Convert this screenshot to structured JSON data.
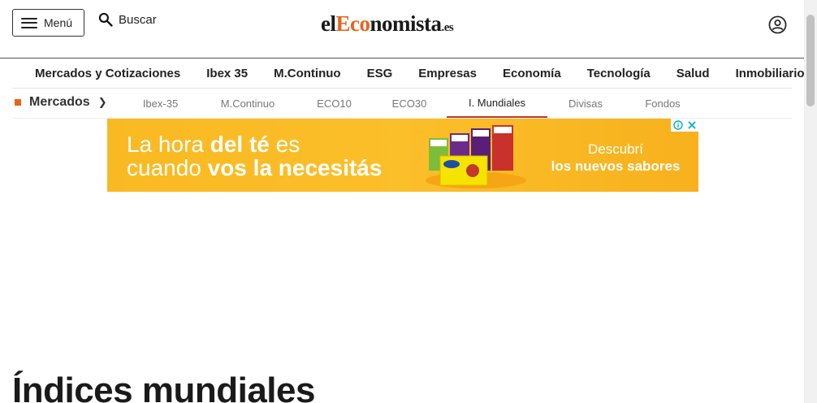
{
  "header": {
    "menu_label": "Menú",
    "search_label": "Buscar",
    "logo": {
      "part1": "el",
      "part2": "Eco",
      "part3": "nomista",
      "tld": ".es"
    }
  },
  "main_nav": [
    "Mercados y Cotizaciones",
    "Ibex 35",
    "M.Continuo",
    "ESG",
    "Empresas",
    "Economía",
    "Tecnología",
    "Salud",
    "Inmobiliario"
  ],
  "sub_nav": {
    "section_label": "Mercados",
    "tabs": [
      {
        "label": "Ibex-35",
        "active": false
      },
      {
        "label": "M.Continuo",
        "active": false
      },
      {
        "label": "ECO10",
        "active": false
      },
      {
        "label": "ECO30",
        "active": false
      },
      {
        "label": "I. Mundiales",
        "active": true
      },
      {
        "label": "Divisas",
        "active": false
      },
      {
        "label": "Fondos",
        "active": false
      }
    ]
  },
  "ad": {
    "line1_regular": "La hora ",
    "line1_bold": "del té",
    "line1_end": " es",
    "line2_regular": "cuando ",
    "line2_bold": "vos la necesitás",
    "cta_line1": "Descubrí",
    "cta_line2": "los nuevos sabores"
  },
  "page_title": "Índices mundiales",
  "colors": {
    "accent": "#e8641b",
    "active_tab": "#c0392b",
    "ad_bg": "#fbbf2a"
  }
}
